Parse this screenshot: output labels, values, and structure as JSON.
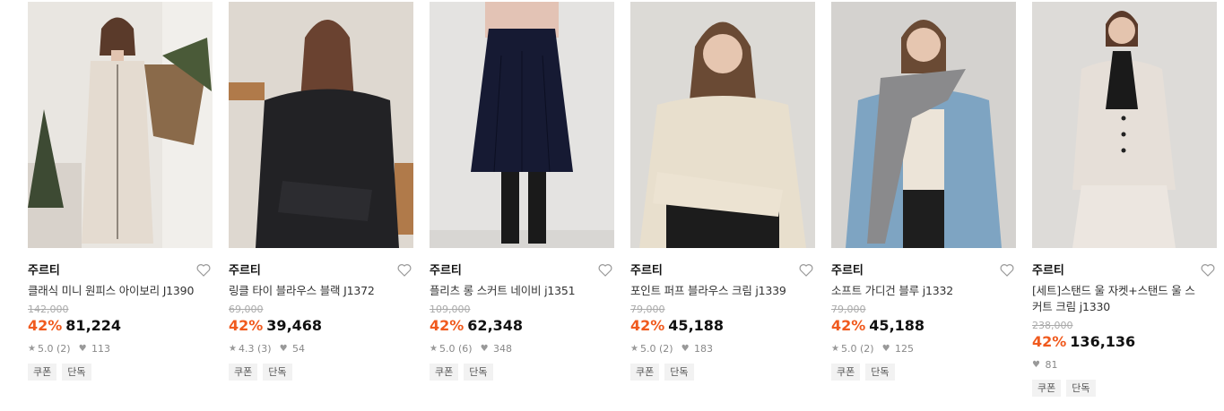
{
  "products": [
    {
      "brand": "주르티",
      "title": "클래식 미니 원피스 아이보리 J1390",
      "original_price": "142,000",
      "discount": "42%",
      "price": "81,224",
      "rating": "5.0",
      "reviews": "(2)",
      "likes": "113",
      "tags": [
        "쿠폰",
        "단독"
      ]
    },
    {
      "brand": "주르티",
      "title": "링클 타이 블라우스 블랙 J1372",
      "original_price": "69,000",
      "discount": "42%",
      "price": "39,468",
      "rating": "4.3",
      "reviews": "(3)",
      "likes": "54",
      "tags": [
        "쿠폰",
        "단독"
      ]
    },
    {
      "brand": "주르티",
      "title": "플리츠 롱 스커트 네이비 j1351",
      "original_price": "109,000",
      "discount": "42%",
      "price": "62,348",
      "rating": "5.0",
      "reviews": "(6)",
      "likes": "348",
      "tags": [
        "쿠폰",
        "단독"
      ]
    },
    {
      "brand": "주르티",
      "title": "포인트 퍼프 블라우스 크림 j1339",
      "original_price": "79,000",
      "discount": "42%",
      "price": "45,188",
      "rating": "5.0",
      "reviews": "(2)",
      "likes": "183",
      "tags": [
        "쿠폰",
        "단독"
      ]
    },
    {
      "brand": "주르티",
      "title": "소프트 가디건 블루 j1332",
      "original_price": "79,000",
      "discount": "42%",
      "price": "45,188",
      "rating": "5.0",
      "reviews": "(2)",
      "likes": "125",
      "tags": [
        "쿠폰",
        "단독"
      ]
    },
    {
      "brand": "주르티",
      "title": "[세트]스탠드 울 자켓+스탠드 울 스커트 크림 j1330",
      "original_price": "238,000",
      "discount": "42%",
      "price": "136,136",
      "likes": "81",
      "tags": [
        "쿠폰",
        "단독"
      ]
    }
  ],
  "icons": {
    "wishlist": "heart-outline-icon",
    "rating": "star-icon",
    "likes": "heart-filled-icon"
  },
  "colors": {
    "discount": "#f05a1e",
    "tag_bg": "#f2f2f2"
  }
}
